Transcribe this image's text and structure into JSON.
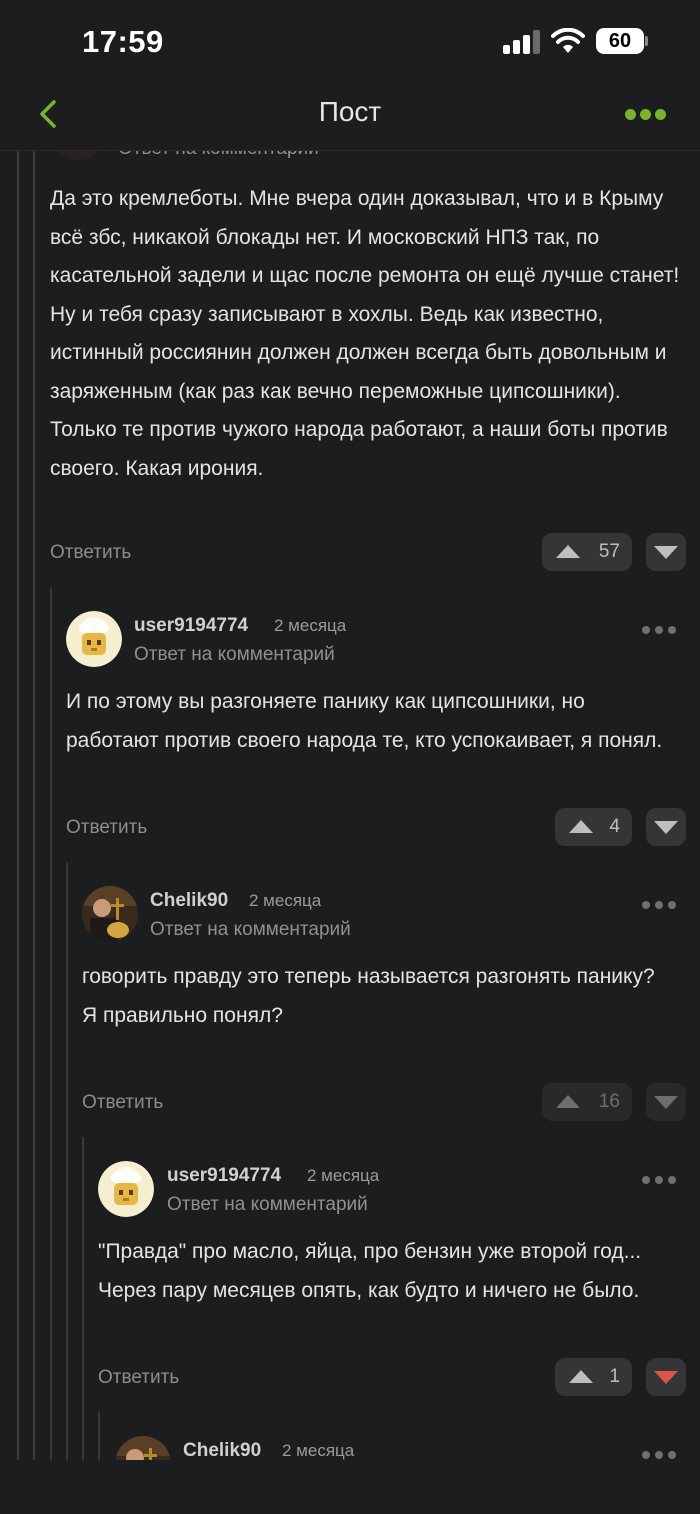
{
  "status_bar": {
    "time": "17:59",
    "battery": "60"
  },
  "nav": {
    "title": "Пост"
  },
  "colors": {
    "accent": "#7bb32e",
    "background": "#1c1d1f",
    "downvote_active": "#e0534a"
  },
  "top_comment": {
    "reply_note": "Ответ на комментарий",
    "text": "Да это кремлеботы. Мне вчера один доказывал, что и в Крыму всё збс, никакой блокады нет. И московский НПЗ так, по касательной задели и щас после ремонта он ещё лучше станет! Ну и тебя сразу записывают в хохлы. Ведь как известно, истинный россиянин должен должен всегда быть довольным и заряженным (как раз как вечно переможные ципсошники). Только те против чужого народа работают, а наши боты против своего. Какая ирония.",
    "reply_label": "Ответить",
    "rating": "57"
  },
  "comments": [
    {
      "username": "user9194774",
      "time": "2 месяца",
      "reply_note": "Ответ на комментарий",
      "text": "И по этому вы разгоняете панику как ципсошники, но работают против своего народа те, кто успокаивает, я понял.",
      "reply_label": "Ответить",
      "rating": "4"
    },
    {
      "username": "Chelik90",
      "time": "2 месяца",
      "reply_note": "Ответ на комментарий",
      "text_line1": "говорить правду это теперь называется разгонять панику?",
      "text_line2": "Я правильно понял?",
      "reply_label": "Ответить",
      "rating": "16"
    },
    {
      "username": "user9194774",
      "time": "2 месяца",
      "reply_note": "Ответ на комментарий",
      "text": "\"Правда\" про масло, яйца, про бензин уже второй год... Через пару месяцев опять, как будто и ничего не было.",
      "reply_label": "Ответить",
      "rating": "1"
    },
    {
      "username": "Chelik90",
      "time": "2 месяца"
    }
  ]
}
